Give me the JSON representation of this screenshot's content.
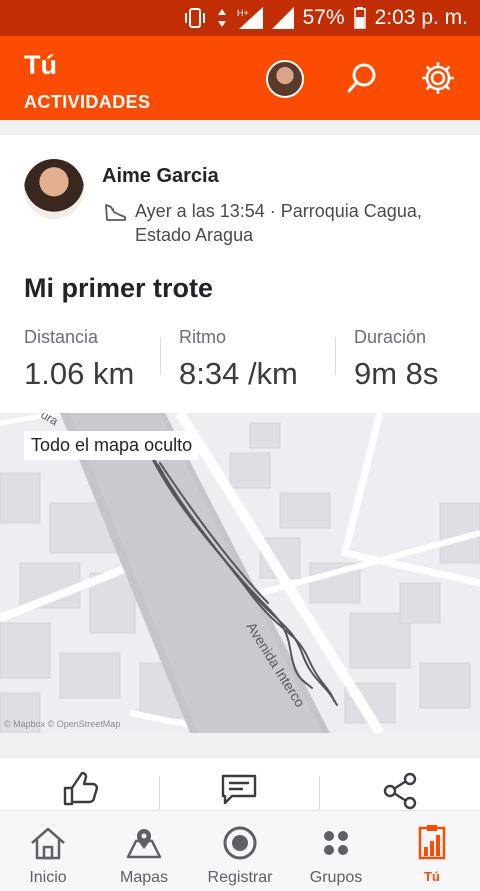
{
  "status_bar": {
    "battery": "57%",
    "time": "2:03 p. m."
  },
  "header": {
    "title": "Tú",
    "subtitle": "ACTIVIDADES"
  },
  "activity": {
    "athlete_name": "Aime Garcia",
    "meta": "Ayer a las 13:54 · Parroquia Cagua, Estado Aragua",
    "title": "Mi primer trote",
    "stats": [
      {
        "label": "Distancia",
        "value": "1.06 km"
      },
      {
        "label": "Ritmo",
        "value": "8:34 /km"
      },
      {
        "label": "Duración",
        "value": "9m 8s"
      }
    ],
    "map": {
      "chip": "Todo el mapa oculto",
      "road_name": "Avenida Interco",
      "road_top_fragment": "ura",
      "credit": "© Mapbox © OpenStreetMap"
    }
  },
  "tabs": [
    {
      "label": "Inicio",
      "icon": "home-icon"
    },
    {
      "label": "Mapas",
      "icon": "map-icon"
    },
    {
      "label": "Registrar",
      "icon": "record-icon"
    },
    {
      "label": "Grupos",
      "icon": "groups-icon"
    },
    {
      "label": "Tú",
      "icon": "profile-chart-icon"
    }
  ],
  "colors": {
    "brand": "#fc4c02",
    "status_bar": "#c12e04",
    "route": "#5a5a64"
  }
}
